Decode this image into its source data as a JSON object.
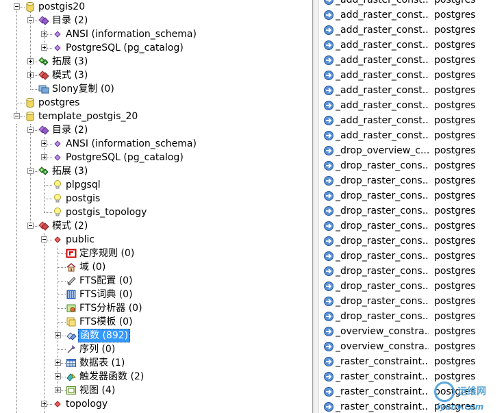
{
  "tree": {
    "nodes": [
      {
        "label": "postgis20",
        "icon": "database-icon",
        "expander": "minus"
      },
      {
        "label": "目录 (2)",
        "icon": "catalog-icon",
        "expander": "minus"
      },
      {
        "label": "ANSI (information_schema)",
        "icon": "diamond-icon",
        "expander": "plus"
      },
      {
        "label": "PostgreSQL (pg_catalog)",
        "icon": "diamond-icon",
        "expander": "plus"
      },
      {
        "label": "拓展 (3)",
        "icon": "extension-icon",
        "expander": "plus"
      },
      {
        "label": "模式 (3)",
        "icon": "schema-icon",
        "expander": "plus"
      },
      {
        "label": "Slony复制 (0)",
        "icon": "replication-icon",
        "expander": "none"
      },
      {
        "label": "postgres",
        "icon": "database-icon",
        "expander": "none"
      },
      {
        "label": "template_postgis_20",
        "icon": "database-icon",
        "expander": "minus"
      },
      {
        "label": "目录 (2)",
        "icon": "catalog-icon",
        "expander": "minus"
      },
      {
        "label": "ANSI (information_schema)",
        "icon": "diamond-icon",
        "expander": "plus"
      },
      {
        "label": "PostgreSQL (pg_catalog)",
        "icon": "diamond-icon",
        "expander": "plus"
      },
      {
        "label": "拓展 (3)",
        "icon": "extension-icon",
        "expander": "minus"
      },
      {
        "label": "plpgsql",
        "icon": "bulb-icon",
        "expander": "none"
      },
      {
        "label": "postgis",
        "icon": "bulb-icon",
        "expander": "none"
      },
      {
        "label": "postgis_topology",
        "icon": "bulb-icon",
        "expander": "none"
      },
      {
        "label": "模式 (2)",
        "icon": "schema-icon",
        "expander": "minus"
      },
      {
        "label": "public",
        "icon": "diamond-red-icon",
        "expander": "minus"
      },
      {
        "label": "定序规则 (0)",
        "icon": "collation-icon",
        "expander": "none"
      },
      {
        "label": "域 (0)",
        "icon": "domain-icon",
        "expander": "none"
      },
      {
        "label": "FTS配置 (0)",
        "icon": "fts-config-icon",
        "expander": "none"
      },
      {
        "label": "FTS词典 (0)",
        "icon": "fts-dictionary-icon",
        "expander": "none"
      },
      {
        "label": "FTS分析器 (0)",
        "icon": "fts-parser-icon",
        "expander": "none"
      },
      {
        "label": "FTS模板 (0)",
        "icon": "fts-template-icon",
        "expander": "none"
      },
      {
        "label": "函数 (892)",
        "icon": "function-icon",
        "expander": "plus",
        "selected": true
      },
      {
        "label": "序列 (0)",
        "icon": "sequence-icon",
        "expander": "none"
      },
      {
        "label": "数据表 (1)",
        "icon": "table-icon",
        "expander": "plus"
      },
      {
        "label": "触发器函数 (2)",
        "icon": "trigger-function-icon",
        "expander": "plus"
      },
      {
        "label": "视图 (4)",
        "icon": "view-icon",
        "expander": "plus"
      },
      {
        "label": "topology",
        "icon": "diamond-red-icon",
        "expander": "plus"
      }
    ]
  },
  "list": {
    "rows": [
      {
        "name": "_add_raster_const...",
        "owner": "postgres"
      },
      {
        "name": "_add_raster_const...",
        "owner": "postgres"
      },
      {
        "name": "_add_raster_const...",
        "owner": "postgres"
      },
      {
        "name": "_add_raster_const...",
        "owner": "postgres"
      },
      {
        "name": "_add_raster_const...",
        "owner": "postgres"
      },
      {
        "name": "_add_raster_const...",
        "owner": "postgres"
      },
      {
        "name": "_add_raster_const...",
        "owner": "postgres"
      },
      {
        "name": "_add_raster_const...",
        "owner": "postgres"
      },
      {
        "name": "_add_raster_const...",
        "owner": "postgres"
      },
      {
        "name": "_add_raster_const...",
        "owner": "postgres"
      },
      {
        "name": "_drop_overview_c...",
        "owner": "postgres"
      },
      {
        "name": "_drop_raster_cons...",
        "owner": "postgres"
      },
      {
        "name": "_drop_raster_cons...",
        "owner": "postgres"
      },
      {
        "name": "_drop_raster_cons...",
        "owner": "postgres"
      },
      {
        "name": "_drop_raster_cons...",
        "owner": "postgres"
      },
      {
        "name": "_drop_raster_cons...",
        "owner": "postgres"
      },
      {
        "name": "_drop_raster_cons...",
        "owner": "postgres"
      },
      {
        "name": "_drop_raster_cons...",
        "owner": "postgres"
      },
      {
        "name": "_drop_raster_cons...",
        "owner": "postgres"
      },
      {
        "name": "_drop_raster_cons...",
        "owner": "postgres"
      },
      {
        "name": "_drop_raster_cons...",
        "owner": "postgres"
      },
      {
        "name": "_drop_raster_cons...",
        "owner": "postgres"
      },
      {
        "name": "_overview_constra...",
        "owner": "postgres"
      },
      {
        "name": "_overview_constra...",
        "owner": "postgres"
      },
      {
        "name": "_raster_constraint...",
        "owner": "postgres"
      },
      {
        "name": "_raster_constraint...",
        "owner": "postgres"
      },
      {
        "name": "_raster_constraint...",
        "owner": "postgres"
      },
      {
        "name": "_raster_constraint...",
        "owner": "postgres"
      }
    ]
  },
  "watermark": {
    "top": "运维网",
    "bottom": "iyunv.com"
  }
}
